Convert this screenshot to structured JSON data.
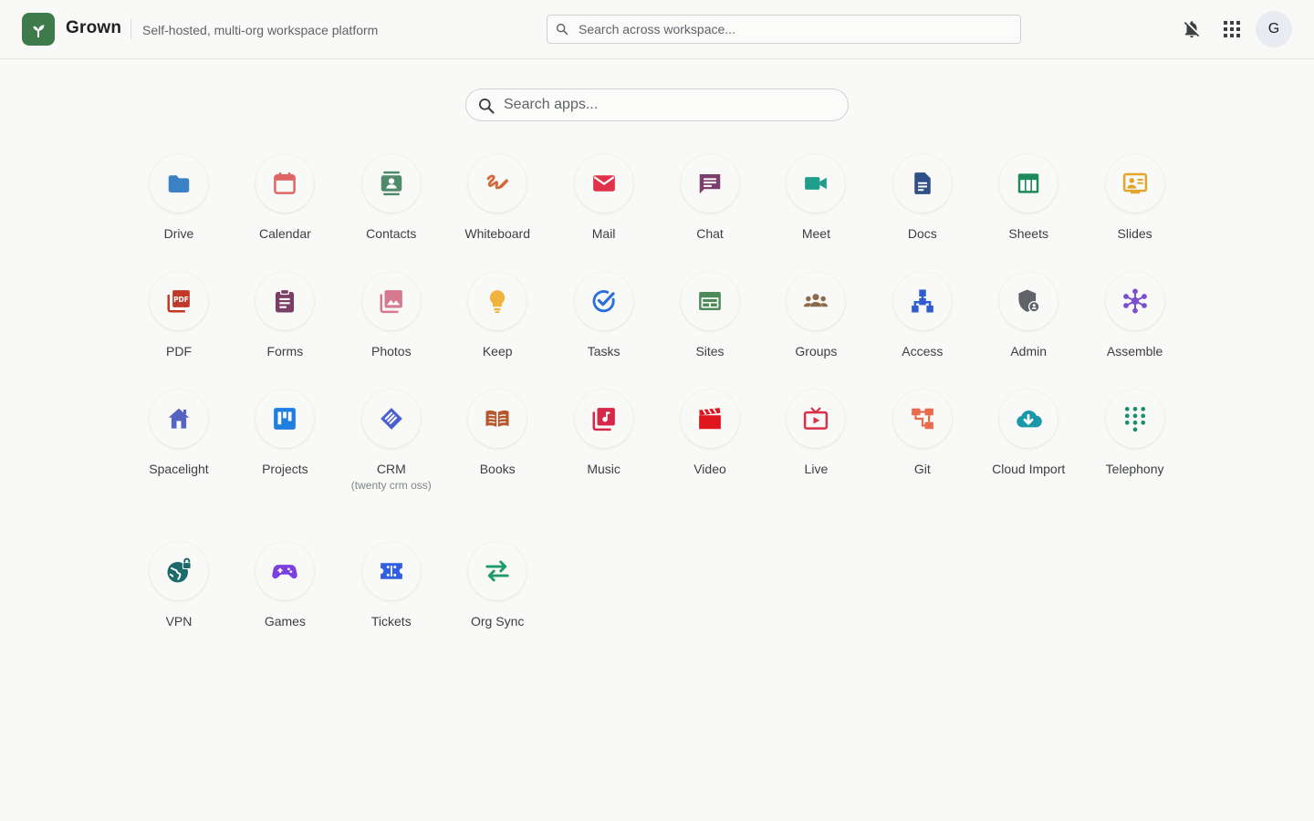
{
  "header": {
    "brand": "Grown",
    "tagline": "Self-hosted, multi-org workspace platform",
    "search_placeholder": "Search across workspace...",
    "avatar_initial": "G",
    "brand_color": "#3f7a4b"
  },
  "launcher": {
    "search_placeholder": "Search apps..."
  },
  "apps": [
    {
      "label": "Drive",
      "icon": "folder-icon",
      "color": "#3b82c4"
    },
    {
      "label": "Calendar",
      "icon": "calendar-icon",
      "color": "#e06666"
    },
    {
      "label": "Contacts",
      "icon": "contacts-icon",
      "color": "#4f8a6b"
    },
    {
      "label": "Whiteboard",
      "icon": "whiteboard-icon",
      "color": "#d2693c"
    },
    {
      "label": "Mail",
      "icon": "mail-icon",
      "color": "#e0334a"
    },
    {
      "label": "Chat",
      "icon": "chat-icon",
      "color": "#7a3f6e"
    },
    {
      "label": "Meet",
      "icon": "video-camera-icon",
      "color": "#1f9e8c"
    },
    {
      "label": "Docs",
      "icon": "document-icon",
      "color": "#2f4f86"
    },
    {
      "label": "Sheets",
      "icon": "sheets-icon",
      "color": "#1e8a5a"
    },
    {
      "label": "Slides",
      "icon": "slides-icon",
      "color": "#e3a52b"
    },
    {
      "label": "PDF",
      "icon": "pdf-icon",
      "color": "#c0392b"
    },
    {
      "label": "Forms",
      "icon": "clipboard-icon",
      "color": "#7a3f66"
    },
    {
      "label": "Photos",
      "icon": "photos-icon",
      "color": "#d57a8e"
    },
    {
      "label": "Keep",
      "icon": "lightbulb-icon",
      "color": "#f2b33d"
    },
    {
      "label": "Tasks",
      "icon": "task-check-icon",
      "color": "#2a6fdb"
    },
    {
      "label": "Sites",
      "icon": "website-icon",
      "color": "#4f8a5b"
    },
    {
      "label": "Groups",
      "icon": "groups-icon",
      "color": "#8a6a4a"
    },
    {
      "label": "Access",
      "icon": "hierarchy-icon",
      "color": "#2f5fcf"
    },
    {
      "label": "Admin",
      "icon": "admin-shield-icon",
      "color": "#5f6368"
    },
    {
      "label": "Assemble",
      "icon": "hub-icon",
      "color": "#7c4fd1"
    },
    {
      "label": "Spacelight",
      "icon": "home-icon",
      "color": "#5563c1"
    },
    {
      "label": "Projects",
      "icon": "kanban-icon",
      "color": "#1e7fe0"
    },
    {
      "label": "CRM",
      "sub": "(twenty crm oss)",
      "icon": "handshake-icon",
      "color": "#4b5fd1"
    },
    {
      "label": "Books",
      "icon": "book-icon",
      "color": "#b5572e"
    },
    {
      "label": "Music",
      "icon": "music-icon",
      "color": "#d6294a"
    },
    {
      "label": "Video",
      "icon": "clapperboard-icon",
      "color": "#e0161e"
    },
    {
      "label": "Live",
      "icon": "live-tv-icon",
      "color": "#d9304a"
    },
    {
      "label": "Git",
      "icon": "git-icon",
      "color": "#ea6a4e"
    },
    {
      "label": "Cloud Import",
      "icon": "cloud-download-icon",
      "color": "#1a97a8"
    },
    {
      "label": "Telephony",
      "icon": "dialpad-icon",
      "color": "#1a8f6a"
    },
    {
      "label": "VPN",
      "icon": "vpn-globe-icon",
      "color": "#1d6a6a"
    },
    {
      "label": "Games",
      "icon": "gamepad-icon",
      "color": "#7c3fe0"
    },
    {
      "label": "Tickets",
      "icon": "ticket-icon",
      "color": "#2f5fe0"
    },
    {
      "label": "Org Sync",
      "icon": "sync-arrows-icon",
      "color": "#1e9a6e"
    }
  ]
}
